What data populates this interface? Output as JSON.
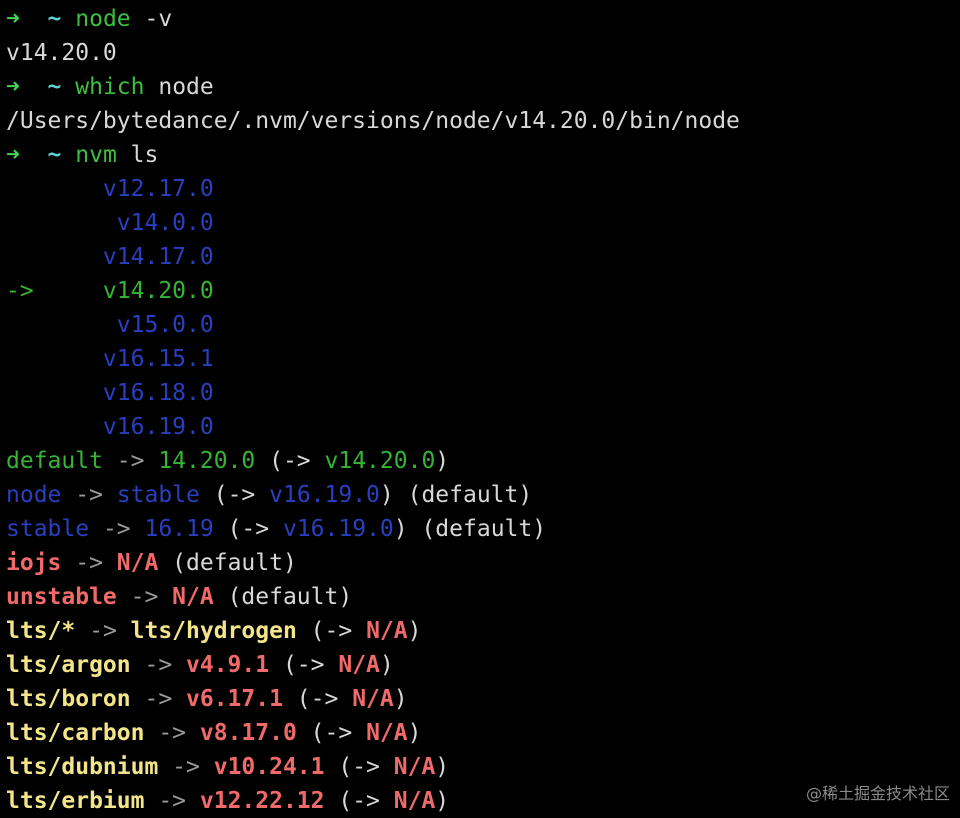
{
  "colors": {
    "prompt_arrow": "#44d15a",
    "prompt_tilde": "#5fd0d5",
    "command": "#3fbf3f",
    "text": "#d8d8d8",
    "blue": "#2a3fbf",
    "green": "#35b535",
    "red": "#f06a6a",
    "yellow": "#f3e58a",
    "grey": "#9a9a9a"
  },
  "terminal": {
    "lines": [
      [
        {
          "t": "➜  ",
          "c": "prompt_arrow",
          "b": true
        },
        {
          "t": "~ ",
          "c": "prompt_tilde",
          "b": true
        },
        {
          "t": "node",
          "c": "command"
        },
        {
          "t": " -v",
          "c": "text"
        }
      ],
      [
        {
          "t": "v14.20.0",
          "c": "text"
        }
      ],
      [
        {
          "t": "➜  ",
          "c": "prompt_arrow",
          "b": true
        },
        {
          "t": "~ ",
          "c": "prompt_tilde",
          "b": true
        },
        {
          "t": "which",
          "c": "command"
        },
        {
          "t": " node",
          "c": "text"
        }
      ],
      [
        {
          "t": "/Users/bytedance/.nvm/versions/node/v14.20.0/bin/node",
          "c": "text"
        }
      ],
      [
        {
          "t": "➜  ",
          "c": "prompt_arrow",
          "b": true
        },
        {
          "t": "~ ",
          "c": "prompt_tilde",
          "b": true
        },
        {
          "t": "nvm",
          "c": "command"
        },
        {
          "t": " ls",
          "c": "text"
        }
      ],
      [
        {
          "t": "       v12.17.0",
          "c": "blue"
        }
      ],
      [
        {
          "t": "        v14.0.0",
          "c": "blue"
        }
      ],
      [
        {
          "t": "       v14.17.0",
          "c": "blue"
        }
      ],
      [
        {
          "t": "->     v14.20.0",
          "c": "green"
        }
      ],
      [
        {
          "t": "        v15.0.0",
          "c": "blue"
        }
      ],
      [
        {
          "t": "       v16.15.1",
          "c": "blue"
        }
      ],
      [
        {
          "t": "       v16.18.0",
          "c": "blue"
        }
      ],
      [
        {
          "t": "       v16.19.0",
          "c": "blue"
        }
      ],
      [
        {
          "t": "default",
          "c": "green"
        },
        {
          "t": " -> ",
          "c": "grey"
        },
        {
          "t": "14.20.0",
          "c": "green"
        },
        {
          "t": " (-> ",
          "c": "text"
        },
        {
          "t": "v14.20.0",
          "c": "green"
        },
        {
          "t": ")",
          "c": "text"
        }
      ],
      [
        {
          "t": "node",
          "c": "blue"
        },
        {
          "t": " -> ",
          "c": "grey"
        },
        {
          "t": "stable",
          "c": "blue"
        },
        {
          "t": " (-> ",
          "c": "text"
        },
        {
          "t": "v16.19.0",
          "c": "blue"
        },
        {
          "t": ") (default)",
          "c": "text"
        }
      ],
      [
        {
          "t": "stable",
          "c": "blue"
        },
        {
          "t": " -> ",
          "c": "grey"
        },
        {
          "t": "16.19",
          "c": "blue"
        },
        {
          "t": " (-> ",
          "c": "text"
        },
        {
          "t": "v16.19.0",
          "c": "blue"
        },
        {
          "t": ") (default)",
          "c": "text"
        }
      ],
      [
        {
          "t": "iojs",
          "c": "red",
          "b": true
        },
        {
          "t": " -> ",
          "c": "grey"
        },
        {
          "t": "N/A",
          "c": "red",
          "b": true
        },
        {
          "t": " (default)",
          "c": "text"
        }
      ],
      [
        {
          "t": "unstable",
          "c": "red",
          "b": true
        },
        {
          "t": " -> ",
          "c": "grey"
        },
        {
          "t": "N/A",
          "c": "red",
          "b": true
        },
        {
          "t": " (default)",
          "c": "text"
        }
      ],
      [
        {
          "t": "lts/*",
          "c": "yellow",
          "b": true
        },
        {
          "t": " -> ",
          "c": "grey"
        },
        {
          "t": "lts/hydrogen",
          "c": "yellow",
          "b": true
        },
        {
          "t": " (-> ",
          "c": "text"
        },
        {
          "t": "N/A",
          "c": "red",
          "b": true
        },
        {
          "t": ")",
          "c": "text"
        }
      ],
      [
        {
          "t": "lts/argon",
          "c": "yellow",
          "b": true
        },
        {
          "t": " -> ",
          "c": "grey"
        },
        {
          "t": "v4.9.1",
          "c": "red",
          "b": true
        },
        {
          "t": " (-> ",
          "c": "text"
        },
        {
          "t": "N/A",
          "c": "red",
          "b": true
        },
        {
          "t": ")",
          "c": "text"
        }
      ],
      [
        {
          "t": "lts/boron",
          "c": "yellow",
          "b": true
        },
        {
          "t": " -> ",
          "c": "grey"
        },
        {
          "t": "v6.17.1",
          "c": "red",
          "b": true
        },
        {
          "t": " (-> ",
          "c": "text"
        },
        {
          "t": "N/A",
          "c": "red",
          "b": true
        },
        {
          "t": ")",
          "c": "text"
        }
      ],
      [
        {
          "t": "lts/carbon",
          "c": "yellow",
          "b": true
        },
        {
          "t": " -> ",
          "c": "grey"
        },
        {
          "t": "v8.17.0",
          "c": "red",
          "b": true
        },
        {
          "t": " (-> ",
          "c": "text"
        },
        {
          "t": "N/A",
          "c": "red",
          "b": true
        },
        {
          "t": ")",
          "c": "text"
        }
      ],
      [
        {
          "t": "lts/dubnium",
          "c": "yellow",
          "b": true
        },
        {
          "t": " -> ",
          "c": "grey"
        },
        {
          "t": "v10.24.1",
          "c": "red",
          "b": true
        },
        {
          "t": " (-> ",
          "c": "text"
        },
        {
          "t": "N/A",
          "c": "red",
          "b": true
        },
        {
          "t": ")",
          "c": "text"
        }
      ],
      [
        {
          "t": "lts/erbium",
          "c": "yellow",
          "b": true
        },
        {
          "t": " -> ",
          "c": "grey"
        },
        {
          "t": "v12.22.12",
          "c": "red",
          "b": true
        },
        {
          "t": " (-> ",
          "c": "text"
        },
        {
          "t": "N/A",
          "c": "red",
          "b": true
        },
        {
          "t": ")",
          "c": "text"
        }
      ]
    ]
  },
  "watermark": "@稀土掘金技术社区"
}
